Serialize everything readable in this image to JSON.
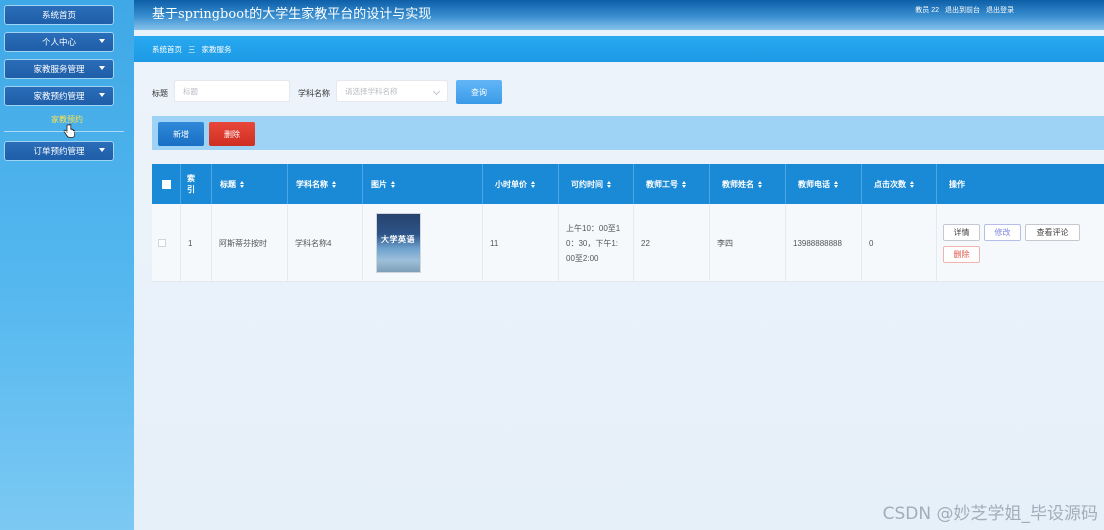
{
  "header": {
    "title": "基于springboot的大学生家教平台的设计与实现",
    "user_label": "教员 22",
    "back_label": "退出到前台",
    "logout_label": "退出登录"
  },
  "sidebar": {
    "items": [
      {
        "label": "系统首页"
      },
      {
        "label": "个人中心"
      },
      {
        "label": "家教服务管理"
      },
      {
        "label": "家教预约管理"
      },
      {
        "label": "订单预约管理"
      }
    ],
    "sub_item": "家教预约"
  },
  "breadcrumb": {
    "home": "系统首页",
    "sep": "三",
    "current": "家教服务"
  },
  "search": {
    "title_label": "标题",
    "title_placeholder": "标题",
    "subject_label": "学科名称",
    "subject_placeholder": "请选择学科名称",
    "query_label": "查询"
  },
  "actions": {
    "add_label": "新增",
    "delete_label": "删除"
  },
  "table": {
    "columns": [
      "索引",
      "标题",
      "学科名称",
      "图片",
      "小时单价",
      "可约时间",
      "教师工号",
      "教师姓名",
      "教师电话",
      "点击次数",
      "操作"
    ],
    "index_header_line1": "索",
    "index_header_line2": "引",
    "rows": [
      {
        "index": "1",
        "title": "阿斯蒂芬按时",
        "subject": "学科名称4",
        "image_title": "大学英语",
        "price": "11",
        "time_line1": "上午10：00至1",
        "time_line2": "0：30，下午1:",
        "time_line3": "00至2:00",
        "teacher_no": "22",
        "teacher_name": "李四",
        "phone": "13988888888",
        "clicks": "0"
      }
    ],
    "ops": {
      "detail": "详情",
      "edit": "修改",
      "comments": "查看评论",
      "delete": "删除"
    }
  },
  "watermark": "CSDN @妙芝学姐_毕设源码"
}
